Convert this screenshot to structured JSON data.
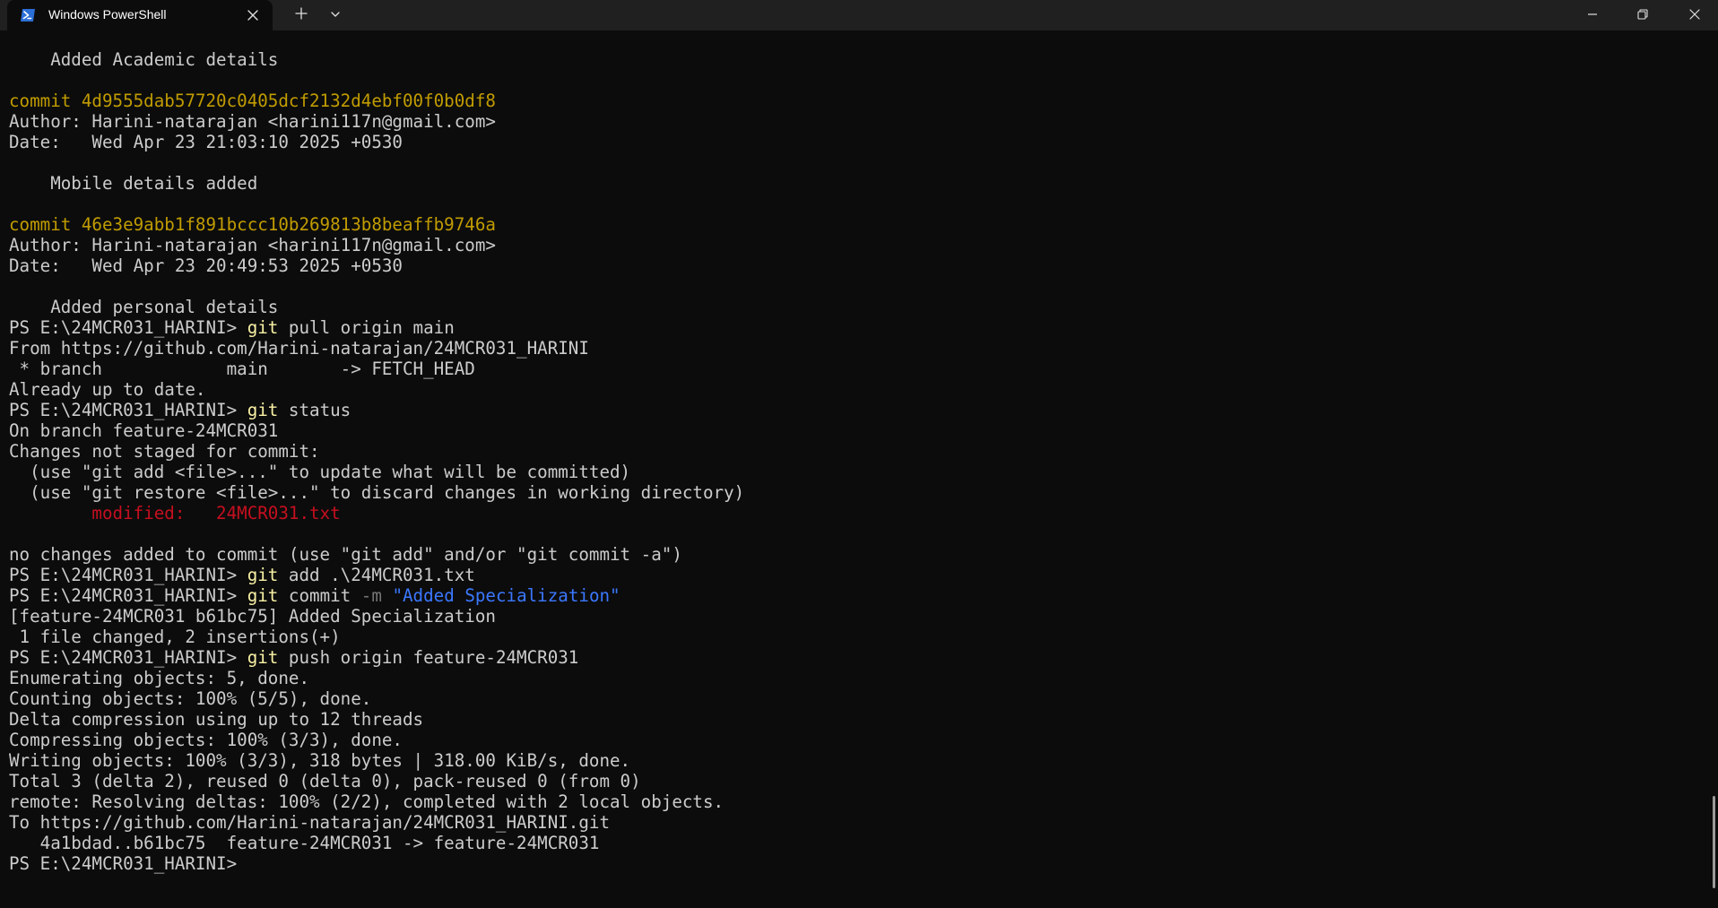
{
  "window": {
    "tab_title": "Windows PowerShell",
    "new_tab_icon": "plus-icon",
    "dropdown_icon": "chevron-down-icon",
    "minimize_icon": "minimize-icon",
    "maximize_icon": "restore-icon",
    "close_icon": "close-icon"
  },
  "colors": {
    "background": "#0c0c0c",
    "titlebar": "#202020",
    "foreground": "#cccccc",
    "commit_hash": "#c19c00",
    "command": "#f9f1a5",
    "modified": "#c50f1f",
    "string_literal": "#3b78ff",
    "parameter": "#767676"
  },
  "terminal": {
    "lines": [
      {
        "segments": [
          {
            "text": ""
          }
        ]
      },
      {
        "segments": [
          {
            "text": "    Added Academic details"
          }
        ]
      },
      {
        "segments": [
          {
            "text": ""
          }
        ]
      },
      {
        "segments": [
          {
            "text": "commit 4d9555dab57720c0405dcf2132d4ebf00f0b0df8",
            "color": "yellow"
          }
        ]
      },
      {
        "segments": [
          {
            "text": "Author: Harini-natarajan <harini117n@gmail.com>"
          }
        ]
      },
      {
        "segments": [
          {
            "text": "Date:   Wed Apr 23 21:03:10 2025 +0530"
          }
        ]
      },
      {
        "segments": [
          {
            "text": ""
          }
        ]
      },
      {
        "segments": [
          {
            "text": "    Mobile details added"
          }
        ]
      },
      {
        "segments": [
          {
            "text": ""
          }
        ]
      },
      {
        "segments": [
          {
            "text": "commit 46e3e9abb1f891bccc10b269813b8beaffb9746a",
            "color": "yellow"
          }
        ]
      },
      {
        "segments": [
          {
            "text": "Author: Harini-natarajan <harini117n@gmail.com>"
          }
        ]
      },
      {
        "segments": [
          {
            "text": "Date:   Wed Apr 23 20:49:53 2025 +0530"
          }
        ]
      },
      {
        "segments": [
          {
            "text": ""
          }
        ]
      },
      {
        "segments": [
          {
            "text": "    Added personal details"
          }
        ]
      },
      {
        "segments": [
          {
            "text": "PS E:\\24MCR031_HARINI> "
          },
          {
            "text": "git",
            "color": "cmd"
          },
          {
            "text": " pull origin main"
          }
        ]
      },
      {
        "segments": [
          {
            "text": "From https://github.com/Harini-natarajan/24MCR031_HARINI"
          }
        ]
      },
      {
        "segments": [
          {
            "text": " * branch            main       -> FETCH_HEAD"
          }
        ]
      },
      {
        "segments": [
          {
            "text": "Already up to date."
          }
        ]
      },
      {
        "segments": [
          {
            "text": "PS E:\\24MCR031_HARINI> "
          },
          {
            "text": "git",
            "color": "cmd"
          },
          {
            "text": " status"
          }
        ]
      },
      {
        "segments": [
          {
            "text": "On branch feature-24MCR031"
          }
        ]
      },
      {
        "segments": [
          {
            "text": "Changes not staged for commit:"
          }
        ]
      },
      {
        "segments": [
          {
            "text": "  (use \"git add <file>...\" to update what will be committed)"
          }
        ]
      },
      {
        "segments": [
          {
            "text": "  (use \"git restore <file>...\" to discard changes in working directory)"
          }
        ]
      },
      {
        "segments": [
          {
            "text": "        "
          },
          {
            "text": "modified:   24MCR031.txt",
            "color": "red"
          }
        ]
      },
      {
        "segments": [
          {
            "text": ""
          }
        ]
      },
      {
        "segments": [
          {
            "text": "no changes added to commit (use \"git add\" and/or \"git commit -a\")"
          }
        ]
      },
      {
        "segments": [
          {
            "text": "PS E:\\24MCR031_HARINI> "
          },
          {
            "text": "git",
            "color": "cmd"
          },
          {
            "text": " add .\\24MCR031.txt"
          }
        ]
      },
      {
        "segments": [
          {
            "text": "PS E:\\24MCR031_HARINI> "
          },
          {
            "text": "git",
            "color": "cmd"
          },
          {
            "text": " commit "
          },
          {
            "text": "-m",
            "color": "gray"
          },
          {
            "text": " "
          },
          {
            "text": "\"Added Specialization\"",
            "color": "string"
          }
        ]
      },
      {
        "segments": [
          {
            "text": "[feature-24MCR031 b61bc75] Added Specialization"
          }
        ]
      },
      {
        "segments": [
          {
            "text": " 1 file changed, 2 insertions(+)"
          }
        ]
      },
      {
        "segments": [
          {
            "text": "PS E:\\24MCR031_HARINI> "
          },
          {
            "text": "git",
            "color": "cmd"
          },
          {
            "text": " push origin feature-24MCR031"
          }
        ]
      },
      {
        "segments": [
          {
            "text": "Enumerating objects: 5, done."
          }
        ]
      },
      {
        "segments": [
          {
            "text": "Counting objects: 100% (5/5), done."
          }
        ]
      },
      {
        "segments": [
          {
            "text": "Delta compression using up to 12 threads"
          }
        ]
      },
      {
        "segments": [
          {
            "text": "Compressing objects: 100% (3/3), done."
          }
        ]
      },
      {
        "segments": [
          {
            "text": "Writing objects: 100% (3/3), 318 bytes | 318.00 KiB/s, done."
          }
        ]
      },
      {
        "segments": [
          {
            "text": "Total 3 (delta 2), reused 0 (delta 0), pack-reused 0 (from 0)"
          }
        ]
      },
      {
        "segments": [
          {
            "text": "remote: Resolving deltas: 100% (2/2), completed with 2 local objects."
          }
        ]
      },
      {
        "segments": [
          {
            "text": "To https://github.com/Harini-natarajan/24MCR031_HARINI.git"
          }
        ]
      },
      {
        "segments": [
          {
            "text": "   4a1bdad..b61bc75  feature-24MCR031 -> feature-24MCR031"
          }
        ]
      },
      {
        "segments": [
          {
            "text": "PS E:\\24MCR031_HARINI> "
          }
        ]
      }
    ]
  }
}
